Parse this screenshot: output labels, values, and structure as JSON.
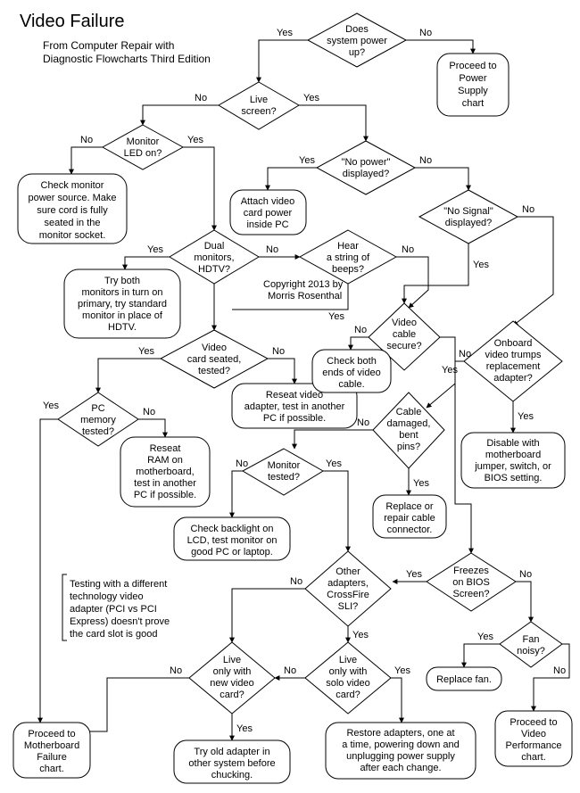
{
  "title": "Video Failure",
  "subtitle_l1": "From Computer Repair with",
  "subtitle_l2": "Diagnostic Flowcharts Third Edition",
  "copyright_l1": "Copyright 2013 by",
  "copyright_l2": "Morris Rosenthal",
  "labels": {
    "yes": "Yes",
    "no": "No"
  },
  "note_l1": "Testing with a different",
  "note_l2": "technology video",
  "note_l3": "adapter  (PCI vs PCI",
  "note_l4": "Express) doesn't prove",
  "note_l5": "the card slot is good",
  "nodes": {
    "n1_l1": "Does",
    "n1_l2": "system power",
    "n1_l3": "up?",
    "n2_l1": "Proceed to",
    "n2_l2": "Power",
    "n2_l3": "Supply",
    "n2_l4": "chart",
    "n3_l1": "Live",
    "n3_l2": "screen?",
    "n4_l1": "Monitor",
    "n4_l2": "LED on?",
    "n5_l1": "Check monitor",
    "n5_l2": "power source. Make",
    "n5_l3": "sure cord is fully",
    "n5_l4": "seated in the",
    "n5_l5": "monitor socket.",
    "n6_l1": "\"No power\"",
    "n6_l2": "displayed?",
    "n7_l1": "Attach video",
    "n7_l2": "card power",
    "n7_l3": "inside PC",
    "n8_l1": "\"No Signal\"",
    "n8_l2": "displayed?",
    "n9_l1": "Dual",
    "n9_l2": "monitors,",
    "n9_l3": "HDTV?",
    "n10_l1": "Try both",
    "n10_l2": "monitors in turn on",
    "n10_l3": "primary, try standard",
    "n10_l4": "monitor in place of",
    "n10_l5": "HDTV.",
    "n11_l1": "Hear",
    "n11_l2": "a string of",
    "n11_l3": "beeps?",
    "n12_l1": "Video",
    "n12_l2": "card  seated,",
    "n12_l3": "tested?",
    "n13_l1": "Reseat video",
    "n13_l2": "adapter, test in another",
    "n13_l3": "PC if possible.",
    "n14_l1": "Video",
    "n14_l2": "cable",
    "n14_l3": "secure?",
    "n15_l1": "Check both",
    "n15_l2": "ends of video",
    "n15_l3": "cable.",
    "n16_l1": "Onboard",
    "n16_l2": "video trumps",
    "n16_l3": "replacement",
    "n16_l4": "adapter?",
    "n17_l1": "Disable with",
    "n17_l2": "motherboard",
    "n17_l3": "jumper, switch, or",
    "n17_l4": "BIOS setting.",
    "n18_l1": "PC",
    "n18_l2": "memory",
    "n18_l3": "tested?",
    "n19_l1": "Reseat",
    "n19_l2": "RAM on",
    "n19_l3": "motherboard,",
    "n19_l4": "test in another",
    "n19_l5": "PC if possible.",
    "n20_l1": "Cable",
    "n20_l2": "damaged,",
    "n20_l3": "bent",
    "n20_l4": "pins?",
    "n21_l1": "Replace or",
    "n21_l2": "repair cable",
    "n21_l3": "connector.",
    "n22_l1": "Monitor",
    "n22_l2": "tested?",
    "n23_l1": "Check backlight on",
    "n23_l2": "LCD, test monitor on",
    "n23_l3": "good PC or laptop.",
    "n24_l1": "Other",
    "n24_l2": "adapters,",
    "n24_l3": "CrossFire",
    "n24_l4": "SLI?",
    "n25_l1": "Freezes",
    "n25_l2": "on BIOS",
    "n25_l3": "Screen?",
    "n26_l1": "Fan",
    "n26_l2": "noisy?",
    "n27_l1": "Replace fan.",
    "n28_l1": "Proceed to",
    "n28_l2": "Video",
    "n28_l3": "Performance",
    "n28_l4": "chart.",
    "n29_l1": "Live",
    "n29_l2": "only with",
    "n29_l3": "solo video",
    "n29_l4": "card?",
    "n30_l1": "Restore adapters, one at",
    "n30_l2": "a time, powering down and",
    "n30_l3": "unplugging power supply",
    "n30_l4": "after each change.",
    "n31_l1": "Live",
    "n31_l2": "only with",
    "n31_l3": "new video",
    "n31_l4": "card?",
    "n32_l1": "Try old adapter in",
    "n32_l2": "other system before",
    "n32_l3": "chucking.",
    "n33_l1": "Proceed to",
    "n33_l2": "Motherboard",
    "n33_l3": "Failure",
    "n33_l4": "chart."
  }
}
